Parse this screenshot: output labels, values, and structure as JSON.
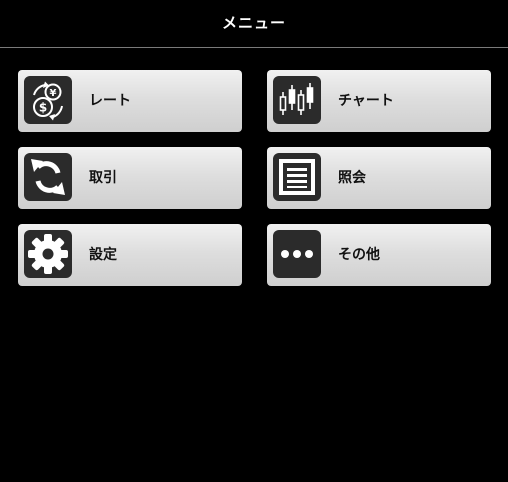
{
  "header": {
    "title": "メニュー"
  },
  "menu": {
    "items": [
      {
        "label": "レート",
        "icon": "exchange-rate-icon"
      },
      {
        "label": "チャート",
        "icon": "candlestick-chart-icon"
      },
      {
        "label": "取引",
        "icon": "swap-arrows-icon"
      },
      {
        "label": "照会",
        "icon": "document-list-icon"
      },
      {
        "label": "設定",
        "icon": "gear-icon"
      },
      {
        "label": "その他",
        "icon": "more-dots-icon"
      }
    ]
  },
  "colors": {
    "background": "#000000",
    "header_text": "#ffffff",
    "divider": "#7a7a7a",
    "button_gradient_top": "#f1f1f1",
    "button_gradient_bottom": "#cfcfcf",
    "icon_tile": "#2b2b2b",
    "icon_glyph": "#ffffff"
  }
}
